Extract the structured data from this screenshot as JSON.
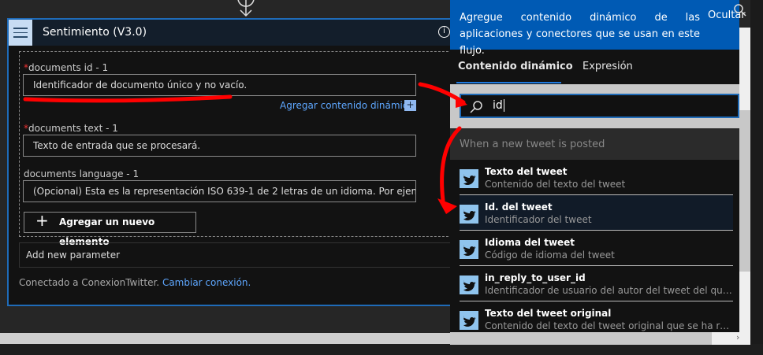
{
  "card": {
    "title": "Sentimiento (V3.0)",
    "info_icon": "info-icon",
    "menu_icon": "hamburger-icon",
    "fields": [
      {
        "label": "documents id - 1",
        "required": true,
        "placeholder": "Identificador de documento único y no vacío."
      },
      {
        "label": "documents text - 1",
        "required": true,
        "placeholder": "Texto de entrada que se procesará."
      },
      {
        "label": "documents language - 1",
        "required": false,
        "placeholder": "(Opcional) Esta es la representación ISO 639-1 de 2 letras de un idioma. Por ejemplo, utilic"
      }
    ],
    "required_mark": "*",
    "add_dynamic": "Agregar contenido dinámico",
    "plus": "+",
    "add_item": "Agregar un nuevo elemento",
    "add_param": "Add new parameter",
    "connected": "Conectado a ConexionTwitter.",
    "change_conn": "Cambiar conexión."
  },
  "panel": {
    "header": "Agregue contenido dinámico de las aplicaciones y conectores que se usan en este flujo.",
    "hide": "Ocultar",
    "tabs": [
      {
        "label": "Contenido dinámico",
        "active": true
      },
      {
        "label": "Expresión",
        "active": false
      }
    ],
    "search_value": "id",
    "group": "When a new tweet is posted",
    "items": [
      {
        "title": "Texto del tweet",
        "subtitle": "Contenido del texto del tweet"
      },
      {
        "title": "Id. del tweet",
        "subtitle": "Identificador del tweet",
        "selected": true
      },
      {
        "title": "Idioma del tweet",
        "subtitle": "Código de idioma del tweet"
      },
      {
        "title": "in_reply_to_user_id",
        "subtitle": "Identificador de usuario del autor del tweet del que es un..."
      },
      {
        "title": "Texto del tweet original",
        "subtitle": "Contenido del texto del tweet original que se ha recupera..."
      }
    ]
  },
  "colors": {
    "accent": "#1f6bb8",
    "panel_header": "#005ab4",
    "link": "#5ea7ff",
    "annotation": "#ff0000"
  }
}
